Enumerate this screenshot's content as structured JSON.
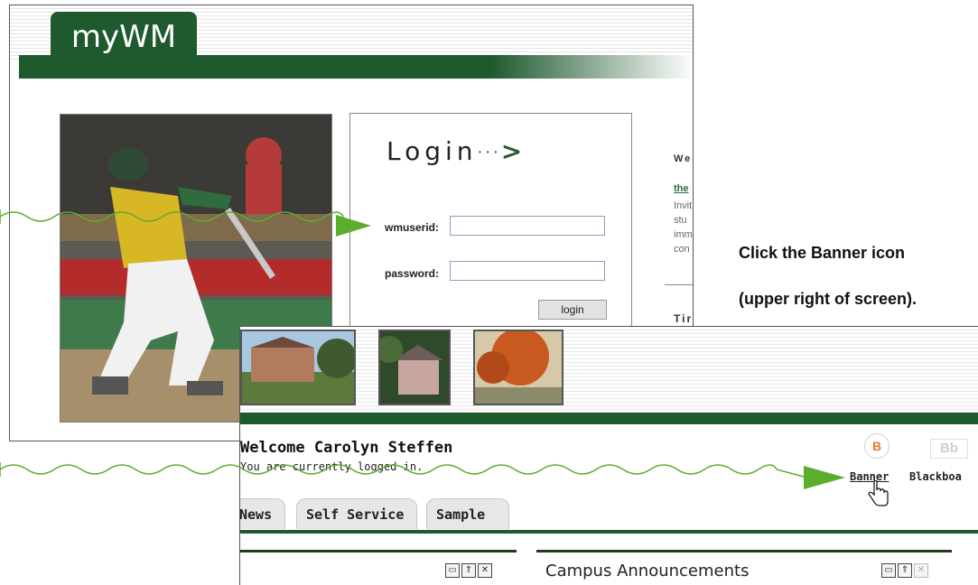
{
  "login_page": {
    "app_tab": "myWM",
    "login_title": "Login",
    "login_dots": "···",
    "login_arrow": ">",
    "userid_label": "wmuserid:",
    "password_label": "password:",
    "login_button": "login",
    "side_fragments": [
      "We",
      "the",
      "Invit",
      "stu",
      "imm",
      "con",
      "Tir"
    ]
  },
  "portal": {
    "welcome": "Welcome Carolyn Steffen",
    "logged_in": "You are currently logged in.",
    "banner_icon": "B",
    "blackboard_icon": "Bb",
    "banner_label": "Banner",
    "blackboard_label": "Blackboa",
    "tabs": [
      "News",
      "Self Service",
      "Sample"
    ],
    "panel_title": "Campus Announcements"
  },
  "instruction": {
    "line1": "Click the Banner icon",
    "line2": "(upper right of screen)."
  },
  "colors": {
    "brand_green": "#1f5a2f",
    "arrow_green": "#5cad2e",
    "banner_orange": "#e8772b"
  }
}
